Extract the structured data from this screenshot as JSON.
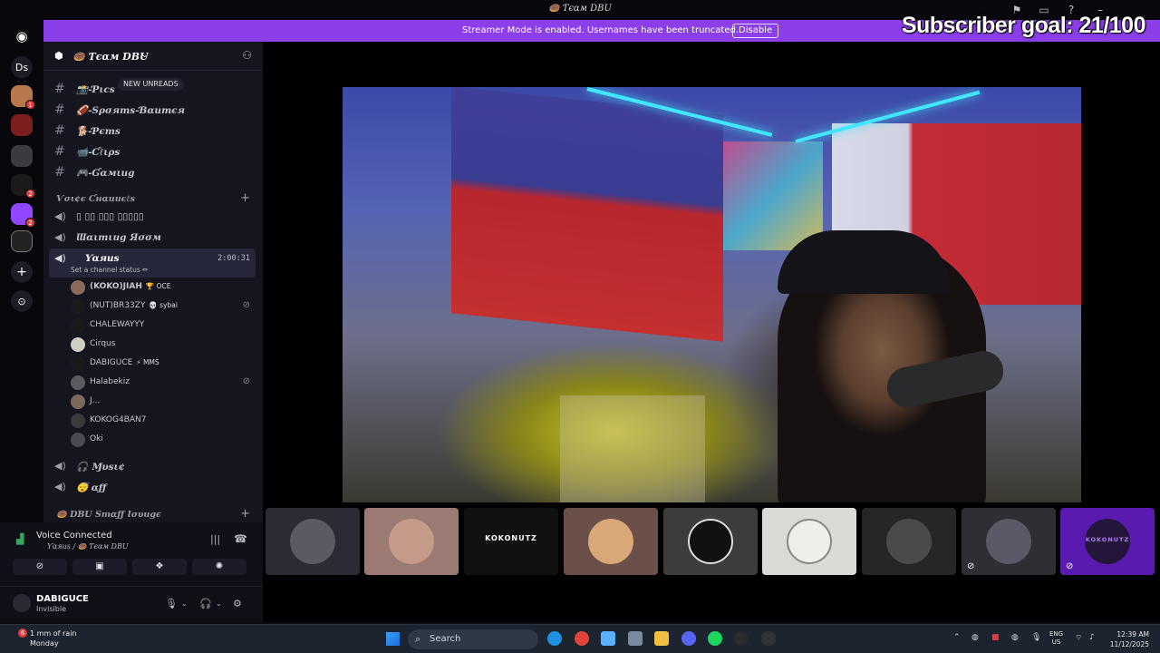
{
  "window": {
    "title": "🍩 Ƭєαм DBU",
    "subscriber_goal": "Subscriber goal: 21/100"
  },
  "banner": {
    "message": "Streamer Mode is enabled. Usernames have been truncated.",
    "disable_label": "Disable"
  },
  "rail": {
    "dm_short": "Ds",
    "badges": [
      "1",
      "2",
      "2"
    ]
  },
  "server": {
    "name": "🍩 Ƭєαм DBU",
    "new_unreads": "NEW UNREADS",
    "text_channels": [
      {
        "label": "📸-Ƥιcѕ"
      },
      {
        "label": "🏈-Ѕρσятѕ-Ɓαитєя"
      },
      {
        "label": "🐕-Ƥєтѕ"
      },
      {
        "label": "📹-Ƈℓιρѕ"
      },
      {
        "label": "🎮-Ɠαмιиg"
      }
    ],
    "voice_category": "Ѵσι¢є Ƈнαииєℓѕ",
    "voice_channels": [
      {
        "label": "▯ ▯▯ ▯▯▯ ▯▯▯▯▯"
      },
      {
        "label": "Ɯαιтιиg Яσσм"
      }
    ],
    "yarns": {
      "label": "Ƴαяиѕ",
      "status": "Set a channel status ✏",
      "timer": "2:00:31"
    },
    "voice_users": [
      {
        "name": "(KOKO)JIAH",
        "tag": "🏆 OCE",
        "muted": false
      },
      {
        "name": "(NUT)BR33ZY",
        "tag": "💀 sybai",
        "muted": true
      },
      {
        "name": "CHALEWAYYY",
        "tag": "",
        "muted": false
      },
      {
        "name": "Cirqus",
        "tag": "",
        "muted": false
      },
      {
        "name": "DABIGUCE",
        "tag": "⚡ MMS",
        "muted": false
      },
      {
        "name": "Halabekiz",
        "tag": "",
        "muted": true
      },
      {
        "name": "J...",
        "tag": "",
        "muted": false
      },
      {
        "name": "KOKOG4BAN7",
        "tag": "",
        "muted": false
      },
      {
        "name": "Oki",
        "tag": "",
        "muted": false
      }
    ],
    "after_channels": [
      {
        "label": "🎧 Ɱυѕι¢"
      },
      {
        "label": "😴 αƒƒ"
      }
    ],
    "staff_category": "🍩 DBU Ѕтαƒƒ Ɩσυиgє"
  },
  "voice_panel": {
    "title": "Voice Connected",
    "subtitle": "Ƴαяиѕ / 🍩 Ƭєαм DBU",
    "user_name": "DABIGUCE",
    "user_status": "Invisible"
  },
  "tiles": [
    {
      "kind": "photo",
      "color": "#3a3a40",
      "muted": false
    },
    {
      "kind": "photo",
      "color": "#9a7a72",
      "muted": false
    },
    {
      "kind": "text",
      "text": "KOKONUTZ",
      "color": "#111111",
      "muted": false
    },
    {
      "kind": "photo",
      "color": "#6a5048",
      "muted": false
    },
    {
      "kind": "photo",
      "color": "#3c3c3c",
      "muted": false
    },
    {
      "kind": "photo",
      "color": "#dcdad4",
      "muted": false
    },
    {
      "kind": "photo",
      "color": "#262626",
      "muted": false
    },
    {
      "kind": "photo",
      "color": "#2e2e34",
      "muted": true
    },
    {
      "kind": "text",
      "text": "KOKONUTZ",
      "color": "#5a1ab0",
      "muted": true
    }
  ],
  "taskbar": {
    "weather_line1": "1 mm of rain",
    "weather_line2": "Monday",
    "weather_badge": "6",
    "search_placeholder": "Search",
    "lang_line1": "ENG",
    "lang_line2": "US",
    "time": "12:39 AM",
    "date": "11/12/2025"
  },
  "colors": {
    "accent": "#8c3ee8",
    "sidebar_bg": "#15151f",
    "selected_channel": "#26263a"
  }
}
